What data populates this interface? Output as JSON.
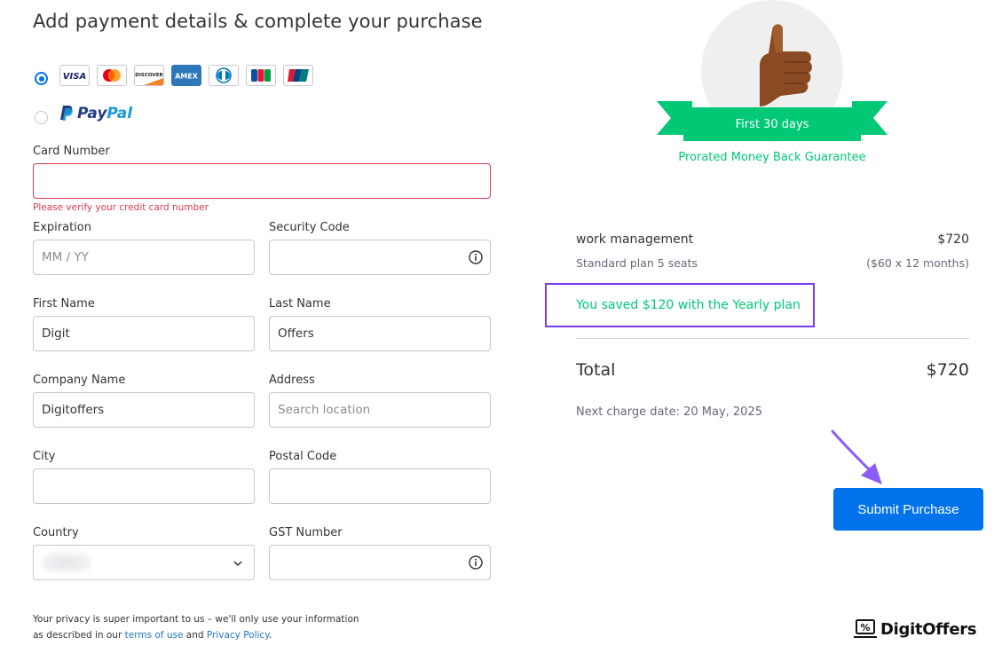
{
  "title": "Add payment details & complete your purchase",
  "payment_methods": {
    "cards": [
      {
        "name": "VISA",
        "color": "#1a1f71"
      },
      {
        "name": "Mastercard",
        "color": "#eb001b"
      },
      {
        "name": "DISCOVER",
        "color": "#f58220"
      },
      {
        "name": "AMEX",
        "color": "#2e77bb"
      },
      {
        "name": "Diners Club",
        "color": "#0079be"
      },
      {
        "name": "JCB",
        "color": "#0b4ea2"
      },
      {
        "name": "UnionPay",
        "color": "#e21836"
      }
    ],
    "paypal_part1": "Pay",
    "paypal_part2": "Pal",
    "selected": "card"
  },
  "form": {
    "card_number_label": "Card Number",
    "card_number_value": "",
    "card_error": "Please verify your credit card number",
    "expiration_label": "Expiration",
    "expiration_placeholder": "MM / YY",
    "security_label": "Security Code",
    "first_name_label": "First Name",
    "first_name_value": "Digit",
    "last_name_label": "Last Name",
    "last_name_value": "Offers",
    "company_label": "Company Name",
    "company_value": "Digitoffers",
    "address_label": "Address",
    "address_placeholder": "Search location",
    "city_label": "City",
    "postal_label": "Postal Code",
    "country_label": "Country",
    "gst_label": "GST Number"
  },
  "privacy": {
    "text1": "Your privacy is super important to us – we'll only use your information",
    "text2": "as described in our ",
    "terms_link": "terms of use",
    "and": " and ",
    "policy_link": "Privacy Policy",
    "end": "."
  },
  "guarantee": {
    "ribbon_text": "First 30 days",
    "caption": "Prorated Money Back Guarantee"
  },
  "summary": {
    "product": "work management",
    "product_price": "$720",
    "plan": "Standard plan 5 seats",
    "plan_detail": "($60 x 12 months)",
    "saved": "You saved $120 with the Yearly plan",
    "total_label": "Total",
    "total_value": "$720",
    "next_charge": "Next charge date: 20 May, 2025"
  },
  "submit_label": "Submit Purchase",
  "brand": "DigitOffers",
  "colors": {
    "primary": "#0073ea",
    "success": "#00c875",
    "error": "#d83a52",
    "highlight": "#7c3aed"
  }
}
